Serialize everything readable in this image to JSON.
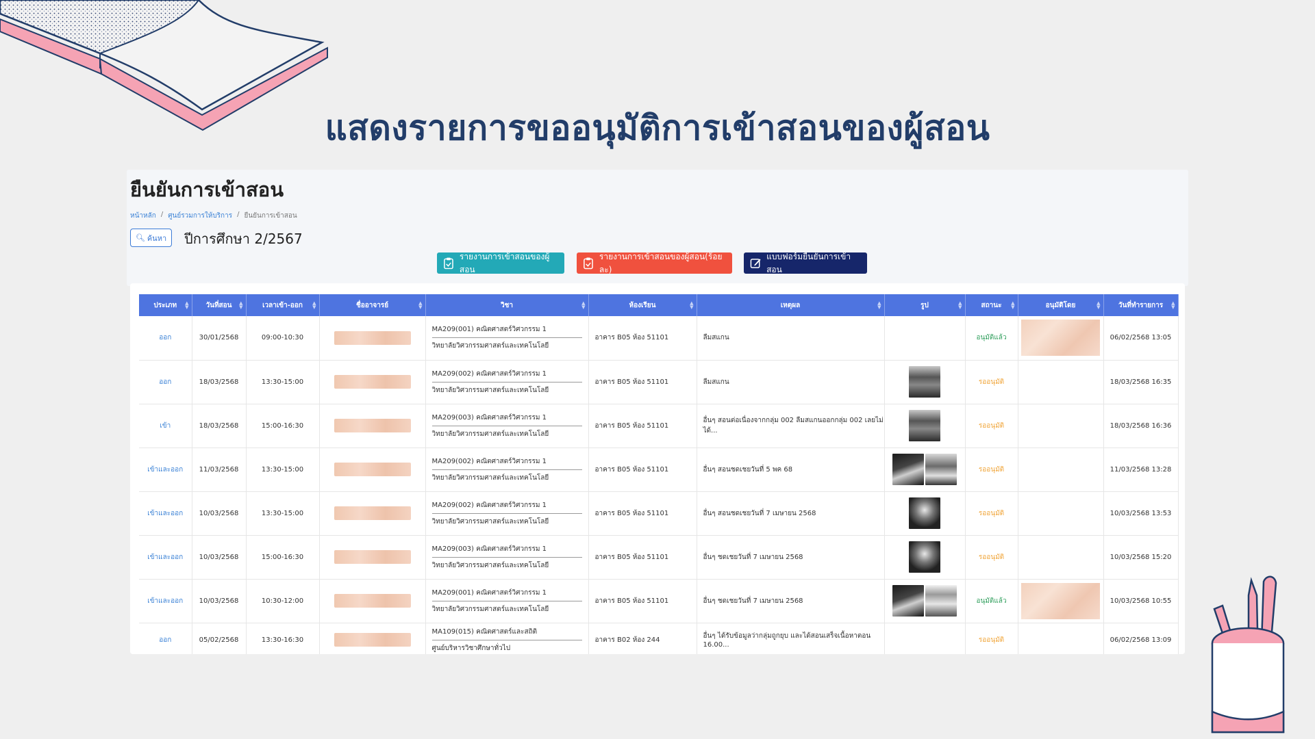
{
  "slide": {
    "title": "แสดงรายการขออนุมัติการเข้าสอนของผู้สอน"
  },
  "page": {
    "heading": "ยืนยันการเข้าสอน",
    "breadcrumb": [
      "หน้าหลัก",
      "ศูนย์รวมการให้บริการ",
      "ยืนยันการเข้าสอน"
    ],
    "search_label": "ค้นหา",
    "year_label": "ปีการศึกษา 2/2567"
  },
  "actions": [
    {
      "label": "รายงานการเข้าสอนของผู้สอน",
      "color": "#23a9b7",
      "icon": "clipboard-icon"
    },
    {
      "label": "รายงานการเข้าสอนของผู้สอน(ร้อยละ)",
      "color": "#f0513e",
      "icon": "clipboard-icon"
    },
    {
      "label": "แบบฟอร์มยืนยันการเข้าสอน",
      "color": "#16266a",
      "icon": "edit-icon"
    }
  ],
  "table": {
    "columns": [
      "ประเภท",
      "วันที่สอน",
      "เวลาเข้า-ออก",
      "ชื่ออาจารย์",
      "วิชา",
      "ห้องเรียน",
      "เหตุผล",
      "รูป",
      "สถานะ",
      "อนุมัติโดย",
      "วันที่ทำรายการ"
    ],
    "rows": [
      {
        "type": "ออก",
        "date": "30/01/2568",
        "time": "09:00-10:30",
        "subject": "MA209(001) คณิตศาสตร์วิศวกรรม 1",
        "faculty": "วิทยาลัยวิศวกรรมศาสตร์และเทคโนโลยี",
        "room": "อาคาร B05 ห้อง 51101",
        "reason": "ลืมสแกน",
        "photos": [],
        "status": "อนุมัติแล้ว",
        "approved": true,
        "created": "06/02/2568 13:05"
      },
      {
        "type": "ออก",
        "date": "18/03/2568",
        "time": "13:30-15:00",
        "subject": "MA209(002) คณิตศาสตร์วิศวกรรม 1",
        "faculty": "วิทยาลัยวิศวกรรมศาสตร์และเทคโนโลยี",
        "room": "อาคาร B05 ห้อง 51101",
        "reason": "ลืมสแกน",
        "photos": [
          "a"
        ],
        "status": "รออนุมัติ",
        "approved": false,
        "created": "18/03/2568 16:35"
      },
      {
        "type": "เข้า",
        "date": "18/03/2568",
        "time": "15:00-16:30",
        "subject": "MA209(003) คณิตศาสตร์วิศวกรรม 1",
        "faculty": "วิทยาลัยวิศวกรรมศาสตร์และเทคโนโลยี",
        "room": "อาคาร B05 ห้อง 51101",
        "reason": "อื่นๆ สอนต่อเนื่องจากกลุ่ม 002 ลืมสแกนออกกลุ่ม 002 เลยไม่ได้...",
        "photos": [
          "a"
        ],
        "status": "รออนุมัติ",
        "approved": false,
        "created": "18/03/2568 16:36"
      },
      {
        "type": "เข้าและออก",
        "date": "11/03/2568",
        "time": "13:30-15:00",
        "subject": "MA209(002) คณิตศาสตร์วิศวกรรม 1",
        "faculty": "วิทยาลัยวิศวกรรมศาสตร์และเทคโนโลยี",
        "room": "อาคาร B05 ห้อง 51101",
        "reason": "อื่นๆ สอนชดเชยวันที่ 5 พค 68",
        "photos": [
          "d",
          "b"
        ],
        "status": "รออนุมัติ",
        "approved": false,
        "created": "11/03/2568 13:28"
      },
      {
        "type": "เข้าและออก",
        "date": "10/03/2568",
        "time": "13:30-15:00",
        "subject": "MA209(002) คณิตศาสตร์วิศวกรรม 1",
        "faculty": "วิทยาลัยวิศวกรรมศาสตร์และเทคโนโลยี",
        "room": "อาคาร B05 ห้อง 51101",
        "reason": "อื่นๆ สอนชดเชยวันที่ 7 เมษายน 2568",
        "photos": [
          "c"
        ],
        "status": "รออนุมัติ",
        "approved": false,
        "created": "10/03/2568 13:53"
      },
      {
        "type": "เข้าและออก",
        "date": "10/03/2568",
        "time": "15:00-16:30",
        "subject": "MA209(003) คณิตศาสตร์วิศวกรรม 1",
        "faculty": "วิทยาลัยวิศวกรรมศาสตร์และเทคโนโลยี",
        "room": "อาคาร B05 ห้อง 51101",
        "reason": "อื่นๆ ชดเชยวันที่ 7 เมษายน 2568",
        "photos": [
          "c"
        ],
        "status": "รออนุมัติ",
        "approved": false,
        "created": "10/03/2568 15:20"
      },
      {
        "type": "เข้าและออก",
        "date": "10/03/2568",
        "time": "10:30-12:00",
        "subject": "MA209(001) คณิตศาสตร์วิศวกรรม 1",
        "faculty": "วิทยาลัยวิศวกรรมศาสตร์และเทคโนโลยี",
        "room": "อาคาร B05 ห้อง 51101",
        "reason": "อื่นๆ ชดเชยวันที่ 7 เมษายน 2568",
        "photos": [
          "d",
          "e"
        ],
        "status": "อนุมัติแล้ว",
        "approved": true,
        "created": "10/03/2568 10:55"
      },
      {
        "type": "ออก",
        "date": "05/02/2568",
        "time": "13:30-16:30",
        "subject": "MA109(015) คณิตศาสตร์และสถิติ",
        "faculty": "ศูนย์บริหารวิชาศึกษาทั่วไป",
        "room": "อาคาร B02 ห้อง 244",
        "reason": "อื่นๆ ได้รับข้อมูลว่ากลุ่มถูกยุบ และได้สอนเสร็จเนื้อหาตอน 16.00...",
        "photos": [],
        "status": "รออนุมัติ",
        "approved": false,
        "created": "06/02/2568 13:09"
      }
    ]
  }
}
